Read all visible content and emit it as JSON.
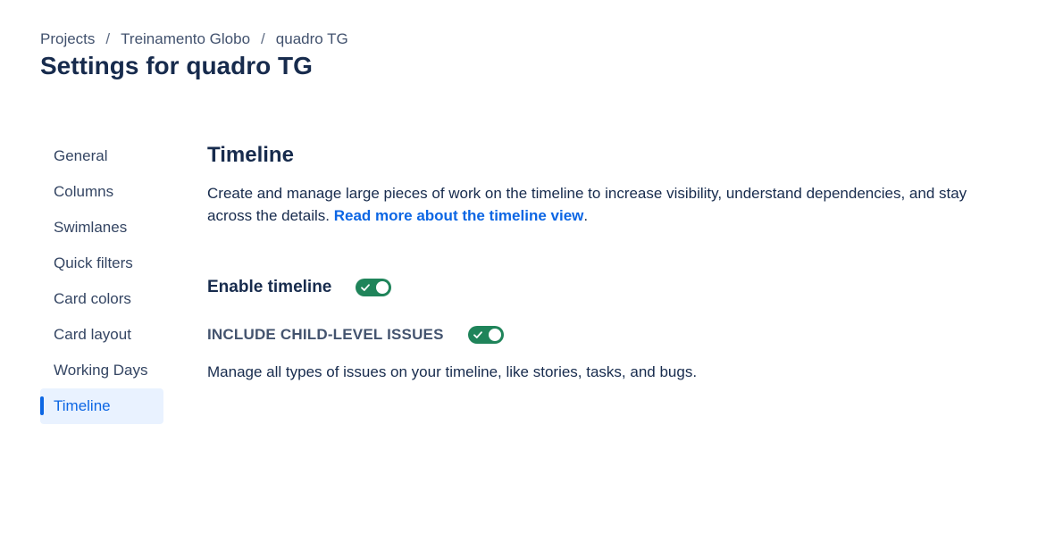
{
  "breadcrumb": {
    "items": [
      "Projects",
      "Treinamento Globo",
      "quadro TG"
    ],
    "separator": "/"
  },
  "page_title": "Settings for quadro TG",
  "sidebar": {
    "items": [
      {
        "label": "General"
      },
      {
        "label": "Columns"
      },
      {
        "label": "Swimlanes"
      },
      {
        "label": "Quick filters"
      },
      {
        "label": "Card colors"
      },
      {
        "label": "Card layout"
      },
      {
        "label": "Working Days"
      },
      {
        "label": "Timeline"
      }
    ],
    "selected": "Timeline"
  },
  "main": {
    "title": "Timeline",
    "description": "Create and manage large pieces of work on the timeline to increase visibility, understand dependencies, and stay across the details. ",
    "link_text": "Read more about the timeline view",
    "description_end": ".",
    "enable_timeline": {
      "label": "Enable timeline",
      "enabled": true
    },
    "include_child": {
      "label": "INCLUDE CHILD-LEVEL ISSUES",
      "enabled": true,
      "helper": "Manage all types of issues on your timeline, like stories, tasks, and bugs."
    }
  },
  "colors": {
    "accent": "#0c66e4",
    "toggle_on": "#1f845a",
    "selected_bg": "#e9f2ff",
    "text": "#172b4d"
  },
  "icons": {
    "toggle_check": "check-icon"
  }
}
